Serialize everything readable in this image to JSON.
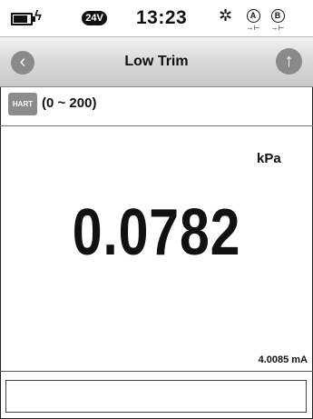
{
  "status_bar": {
    "battery_icon": "battery-icon",
    "charging_glyph": "ϟ",
    "supply_badge": "24V",
    "time": "13:23",
    "bluetooth_glyph": "✲",
    "channel_a": {
      "letter": "A",
      "diode": "→⊢"
    },
    "channel_b": {
      "letter": "B",
      "diode": "→⊢"
    }
  },
  "title_bar": {
    "back_glyph": "‹",
    "title": "Low Trim",
    "upload_glyph": "↑"
  },
  "main": {
    "hart_badge": "HART",
    "range": "(0 ~ 200)",
    "unit": "kPa",
    "reading": "0.0782",
    "current": "4.0085 mA"
  },
  "message_box": {
    "text": ""
  }
}
